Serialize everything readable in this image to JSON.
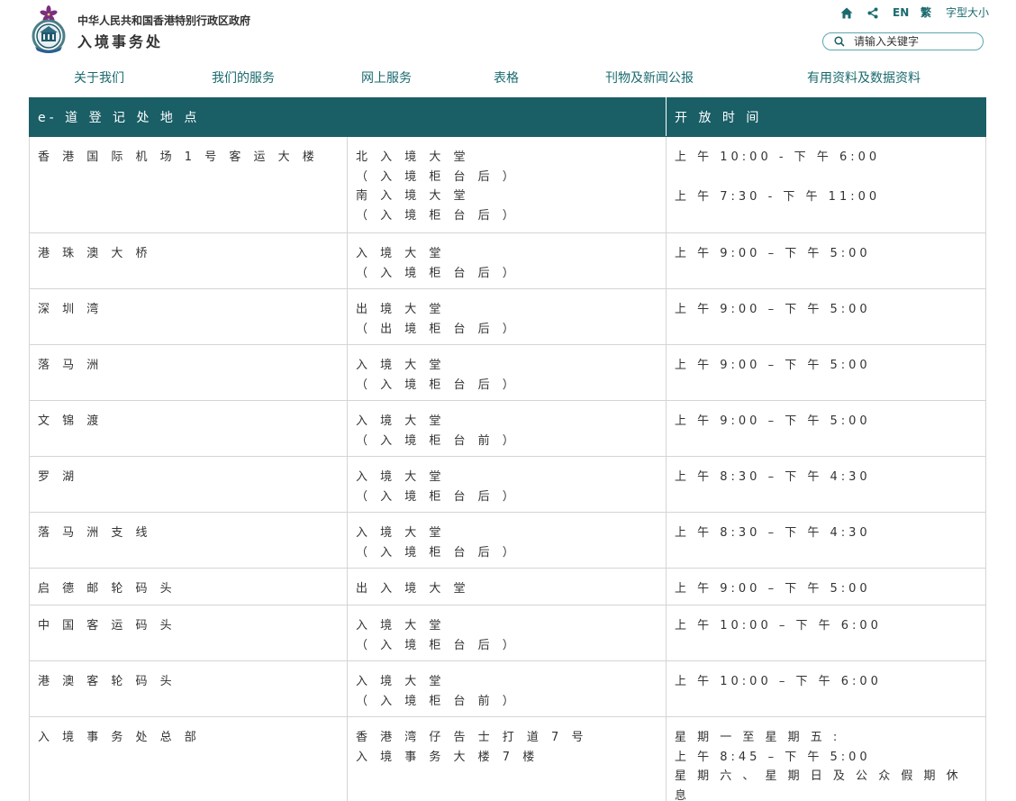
{
  "header": {
    "gov_name": "中华人民共和国香港特别行政区政府",
    "dept_name": "入境事务处",
    "utils": {
      "en": "EN",
      "tc": "繁",
      "font_size": "字型大小"
    },
    "search": {
      "placeholder": "请输入关键字"
    },
    "icons": [
      "home-icon",
      "share-icon",
      "search-icon"
    ],
    "accent_color": "#1a6a6e"
  },
  "nav": {
    "items": [
      "关于我们",
      "我们的服务",
      "网上服务",
      "表格",
      "刊物及新闻公报",
      "有用资料及数据资料"
    ]
  },
  "table": {
    "header_color": "#1a5e66",
    "columns": [
      "e- 道 登 记 处 地 点",
      "开 放 时 间"
    ],
    "rows": [
      {
        "location": "香 港 国 际 机 场 1 号 客 运 大 楼",
        "area_lines": [
          "北 入 境 大 堂",
          "（ 入 境 柜 台 后 ）",
          "南 入 境 大 堂",
          "（ 入 境 柜 台 后 ）"
        ],
        "hours_lines": [
          "上 午 10:00  -  下 午 6:00",
          "",
          "上 午 7:30  -  下 午 11:00"
        ]
      },
      {
        "location": "港 珠 澳 大 桥",
        "area_lines": [
          "入 境 大 堂",
          "（ 入 境 柜 台 后 ）"
        ],
        "hours_lines": [
          "上 午 9:00 – 下 午 5:00"
        ]
      },
      {
        "location": "深 圳 湾",
        "area_lines": [
          "出 境 大 堂",
          "（ 出 境 柜 台 后 ）"
        ],
        "hours_lines": [
          "上 午 9:00 – 下 午 5:00"
        ]
      },
      {
        "location": "落 马 洲",
        "area_lines": [
          "入 境 大 堂",
          "（ 入 境 柜 台 后 ）"
        ],
        "hours_lines": [
          "上 午 9:00 – 下 午 5:00"
        ]
      },
      {
        "location": "文 锦 渡",
        "area_lines": [
          "入 境 大 堂",
          "（ 入 境 柜 台 前 ）"
        ],
        "hours_lines": [
          "上 午 9:00 – 下 午 5:00"
        ]
      },
      {
        "location": "罗 湖",
        "area_lines": [
          "入 境 大 堂",
          "（ 入 境 柜 台 后 ）"
        ],
        "hours_lines": [
          "上 午 8:30 – 下 午 4:30"
        ]
      },
      {
        "location": "落 马 洲 支 线",
        "area_lines": [
          "入 境 大 堂",
          "（ 入 境 柜 台 后 ）"
        ],
        "hours_lines": [
          "上 午 8:30 – 下 午 4:30"
        ]
      },
      {
        "location": "启 德 邮 轮 码 头",
        "area_lines": [
          "出 入 境 大 堂"
        ],
        "hours_lines": [
          "上 午 9:00 – 下 午 5:00"
        ]
      },
      {
        "location": "中 国 客 运 码 头",
        "area_lines": [
          "入 境 大 堂",
          "（ 入 境 柜 台 后 ）"
        ],
        "hours_lines": [
          "上 午 10:00 – 下 午 6:00"
        ]
      },
      {
        "location": "港 澳 客 轮 码 头",
        "area_lines": [
          "入 境 大 堂",
          "（ 入 境 柜 台 前 ）"
        ],
        "hours_lines": [
          "上 午 10:00 – 下 午 6:00"
        ]
      },
      {
        "location": "入 境 事 务 处 总 部",
        "area_lines": [
          "香 港 湾 仔 告 士 打 道 7 号",
          "入 境 事 务 大 楼 7 楼"
        ],
        "hours_lines": [
          "星 期 一 至 星 期 五 :",
          "上 午 8:45 – 下 午 5:00",
          "星 期 六 、 星 期 日 及 公 众 假 期 休 息"
        ]
      }
    ]
  }
}
